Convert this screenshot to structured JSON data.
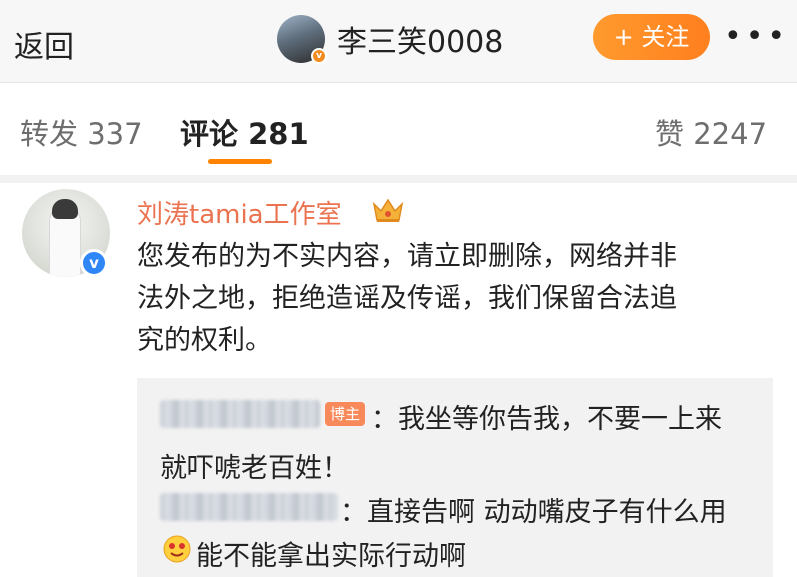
{
  "nav": {
    "back_label": "返回",
    "author_name": "李三笑0008",
    "follow_label": "+ 关注",
    "more_label": "•••"
  },
  "tabs": [
    {
      "label": "转发 337",
      "active": false
    },
    {
      "label": "评论 281",
      "active": true
    },
    {
      "label": "赞 2247",
      "active": false
    }
  ],
  "comment": {
    "author": "刘涛tamia工作室",
    "lines": [
      "您发布的为不实内容，请立即删除，网络并非",
      "法外之地，拒绝造谣及传谣，我们保留合法追",
      "究的权利。"
    ]
  },
  "replies": [
    {
      "badge": "博主",
      "text_line1": "：我坐等你告我，不要一上来",
      "text_line2": "就吓唬老百姓！"
    },
    {
      "text_line1": "：直接告啊 动动嘴皮子有什么用",
      "text_line2": "能不能拿出实际行动啊"
    }
  ],
  "colors": {
    "accent": "#ff8200",
    "author_name": "#eb7350",
    "follow_btn": "#ff8a26",
    "verified": "#2f86f6",
    "host_badge": "#f8895b"
  },
  "icons": [
    "crown-icon",
    "verified-icon",
    "emoji-icon",
    "more-icon"
  ]
}
